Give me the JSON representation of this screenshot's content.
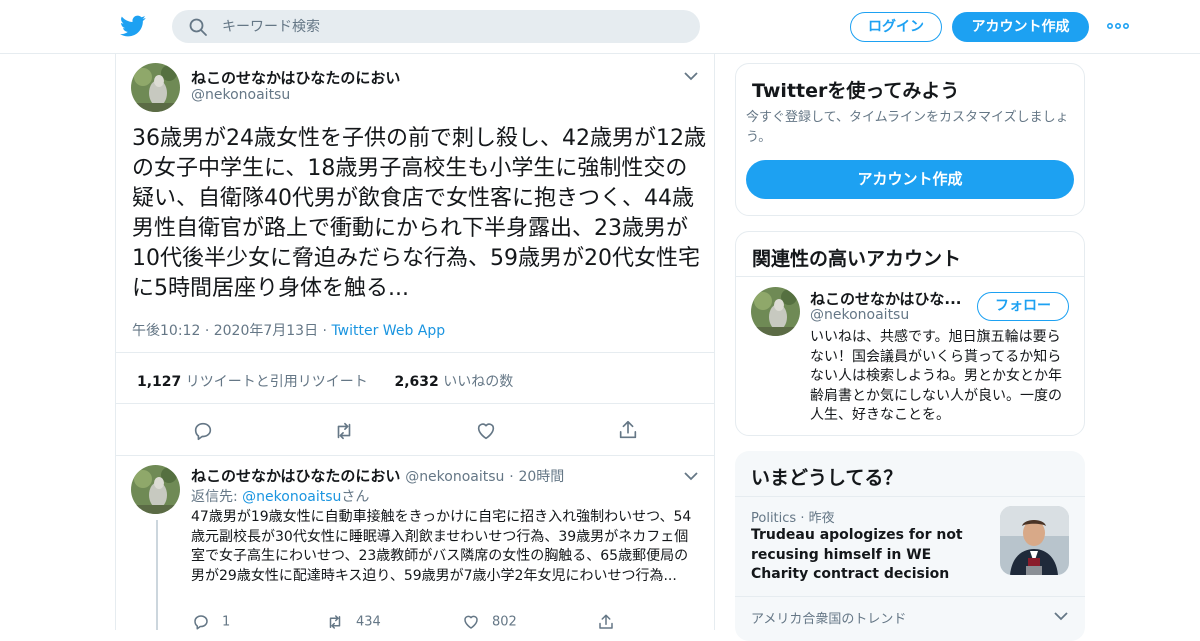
{
  "header": {
    "search_placeholder": "キーワード検索",
    "login_label": "ログイン",
    "signup_label": "アカウント作成"
  },
  "tweet": {
    "display_name": "ねこのせなかはひなたのにおい",
    "handle": "@nekonoaitsu",
    "text": "36歳男が24歳女性を子供の前で刺し殺し、42歳男が12歳の女子中学生に、18歳男子高校生も小学生に強制性交の疑い、自衛隊40代男が飲食店で女性客に抱きつく、44歳男性自衛官が路上で衝動にかられ下半身露出、23歳男が10代後半少女に脅迫みだらな行為、59歳男が20代女性宅に5時間居座り身体を触る...",
    "time": "午後10:12",
    "date": "2020年7月13日",
    "sep": "·",
    "source": "Twitter Web App",
    "retweets": "1,127",
    "retweets_label": "リツイートと引用リツイート",
    "likes": "2,632",
    "likes_label": "いいねの数"
  },
  "reply": {
    "display_name": "ねこのせなかはひなたのにおい",
    "handle": "@nekonoaitsu",
    "sep": "·",
    "age": "20時間",
    "reply_to_prefix": "返信先: ",
    "reply_to_handle": "@nekonoaitsu",
    "reply_to_suffix": "さん",
    "text": "47歳男が19歳女性に自動車接触をきっかけに自宅に招き入れ強制わいせつ、54歳元副校長が30代女性に睡眠導入剤飲ませわいせつ行為、39歳男がネカフェ個室で女子高生にわいせつ、23歳教師がバス隣席の女性の胸触る、65歳郵便局の男が29歳女性に配達時キス迫り、59歳男が7歳小学2年女児にわいせつ行為...",
    "reply_count": "1",
    "retweet_count": "434",
    "like_count": "802"
  },
  "signup_card": {
    "title": "Twitterを使ってみよう",
    "subtitle": "今すぐ登録して、タイムラインをカスタマイズしましょう。",
    "button": "アカウント作成"
  },
  "related_card": {
    "title": "関連性の高いアカウント",
    "display_name": "ねこのせなかはひな...",
    "handle": "@nekonoaitsu",
    "follow_label": "フォロー",
    "bio": "いいねは、共感です。旭日旗五輪は要らない！国会議員がいくら貰ってるか知らない人は検索しようね。男とか女とか年齢肩書とか気にしない人が良い。一度の人生、好きなことを。"
  },
  "trends_card": {
    "title": "いまどうしてる？",
    "category": "Politics",
    "sep": "·",
    "time": "昨夜",
    "headline": "Trudeau apologizes for not recusing himself in WE Charity contract decision",
    "footer": "アメリカ合衆国のトレンド"
  },
  "colors": {
    "accent": "#1da1f2",
    "link": "#1b95e0",
    "muted": "#657786",
    "border": "#e6ecf0"
  }
}
